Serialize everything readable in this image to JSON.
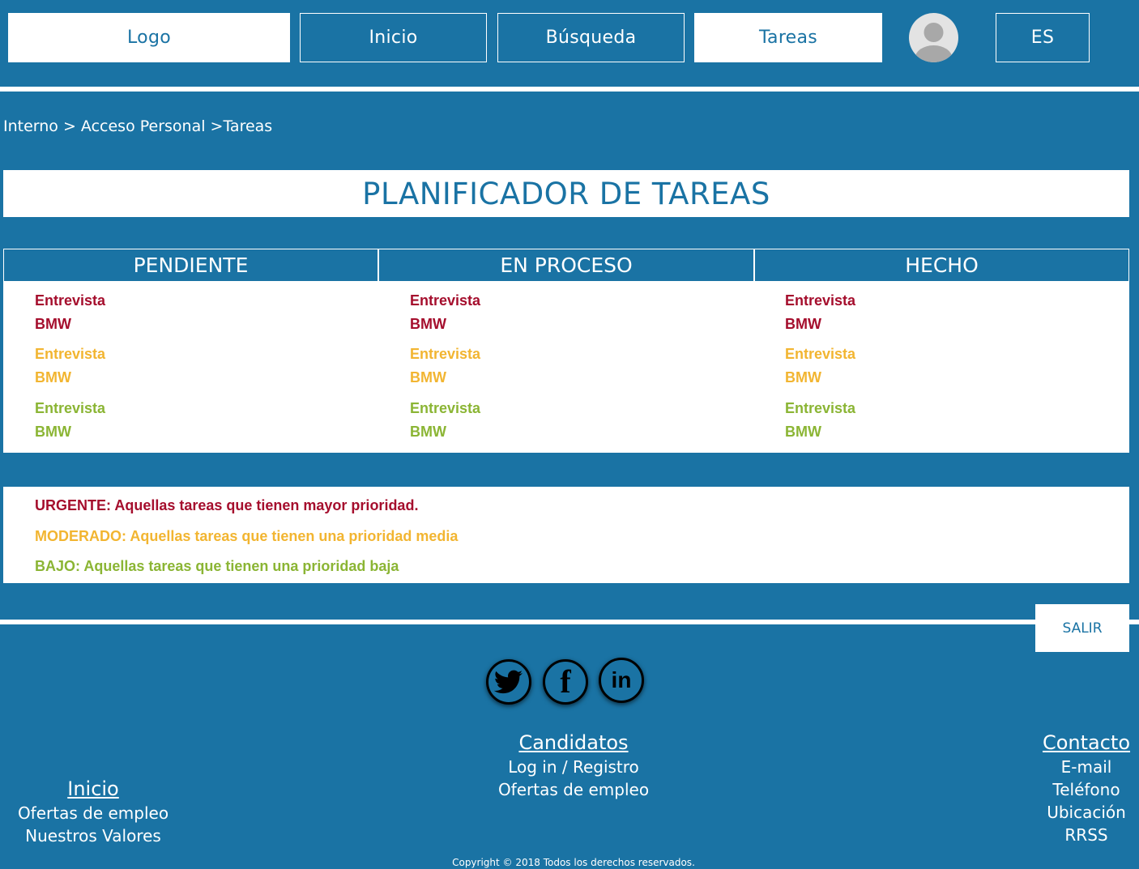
{
  "nav": {
    "logo": "Logo",
    "inicio": "Inicio",
    "busqueda": "Búsqueda",
    "tareas": "Tareas",
    "language": "ES"
  },
  "breadcrumb": "Interno > Acceso Personal >Tareas",
  "title": "PLANIFICADOR DE TAREAS",
  "columns": [
    "PENDIENTE",
    "EN PROCESO",
    "HECHO"
  ],
  "tasks": {
    "line1": "Entrevista",
    "line2": "BMW"
  },
  "legend": {
    "urgente": "URGENTE: Aquellas tareas que tienen mayor prioridad.",
    "moderado": "MODERADO: Aquellas tareas que tienen una prioridad media",
    "bajo": "BAJO: Aquellas tareas que tienen una prioridad baja"
  },
  "salir": "SALIR",
  "footer": {
    "inicio": {
      "heading": "Inicio",
      "links": [
        "Ofertas de empleo",
        "Nuestros Valores"
      ]
    },
    "candidatos": {
      "heading": "Candidatos",
      "links": [
        "Log in / Registro",
        "Ofertas de empleo"
      ]
    },
    "contacto": {
      "heading": "Contacto",
      "links": [
        "E-mail",
        "Teléfono",
        "Ubicación",
        "RRSS"
      ]
    },
    "copyright": "Copyright © 2018 Todos los derechos reservados."
  },
  "social_icons": [
    "twitter-icon",
    "facebook-icon",
    "linkedin-icon"
  ],
  "colors": {
    "background": "#1a73a4",
    "urgent": "#a50e2d",
    "moderate": "#f2b531",
    "low": "#8bb534"
  }
}
